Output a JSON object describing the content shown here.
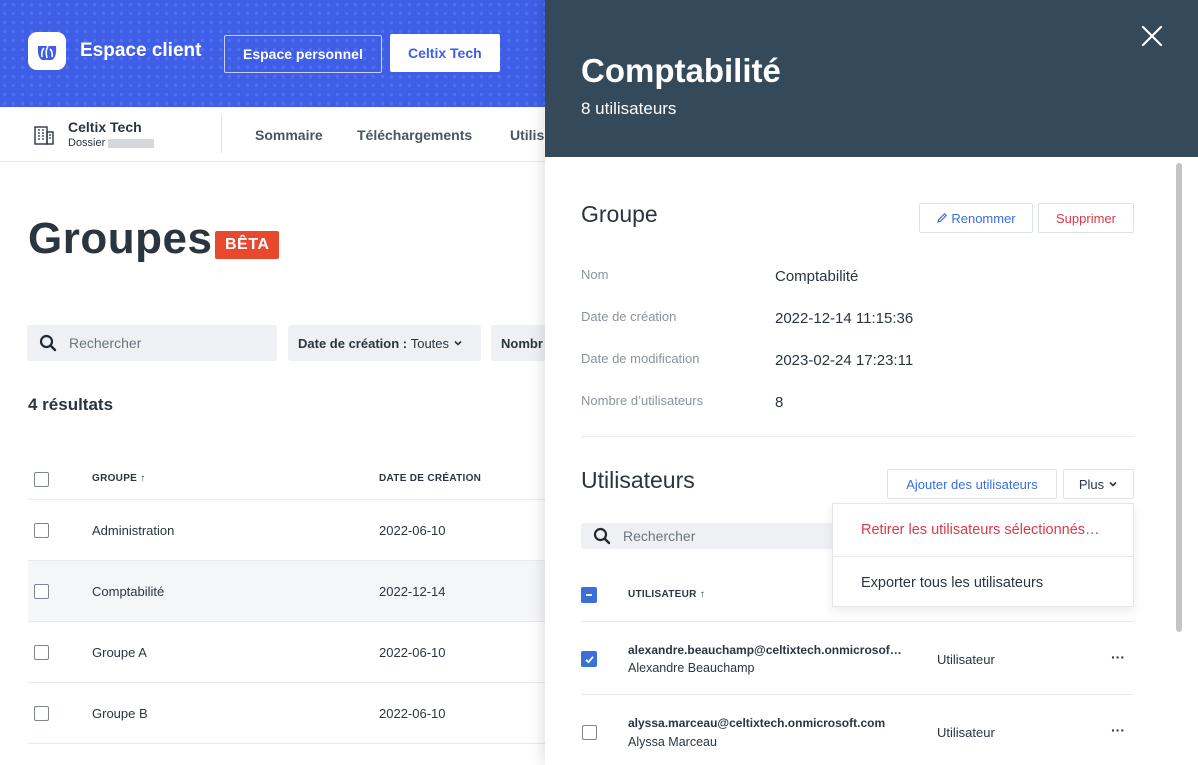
{
  "header": {
    "app_title": "Espace client",
    "btn_personal": "Espace personnel",
    "btn_org": "Celtix Tech",
    "colors": {
      "brand": "#3e5ee8",
      "accent_red": "#e8492d"
    }
  },
  "subnav": {
    "org_name": "Celtix Tech",
    "org_sub": "Dossier",
    "links": [
      "Sommaire",
      "Téléchargements",
      "Utilis"
    ]
  },
  "page": {
    "title": "Groupes",
    "badge": "BÊTA",
    "search_placeholder": "Rechercher",
    "filter_created_label": "Date de création :",
    "filter_created_value": "Toutes",
    "filter_count_label": "Nombr",
    "results": "4 résultats",
    "columns": {
      "group": "GROUPE",
      "created": "DATE DE CRÉATION"
    },
    "rows": [
      {
        "name": "Administration",
        "date": "2022-06-10"
      },
      {
        "name": "Comptabilité",
        "date": "2022-12-14"
      },
      {
        "name": "Groupe A",
        "date": "2022-06-10"
      },
      {
        "name": "Groupe B",
        "date": "2022-06-10"
      }
    ]
  },
  "drawer": {
    "title": "Comptabilité",
    "subtitle": "8 utilisateurs",
    "group_section": "Groupe",
    "btn_rename": "Renommer",
    "btn_delete": "Supprimer",
    "fields": [
      {
        "label": "Nom",
        "value": "Comptabilité"
      },
      {
        "label": "Date de création",
        "value": "2022-12-14 11:15:36"
      },
      {
        "label": "Date de modification",
        "value": "2023-02-24 17:23:11"
      },
      {
        "label": "Nombre d’utilisateurs",
        "value": "8"
      }
    ],
    "users_section": "Utilisateurs",
    "btn_add_users": "Ajouter des utilisateurs",
    "btn_more": "Plus",
    "search_placeholder": "Rechercher",
    "col_user": "UTILISATEUR",
    "menu": {
      "remove_selected": "Retirer les utilisateurs sélectionnés…",
      "export_all": "Exporter tous les utilisateurs"
    },
    "users": [
      {
        "email": "alexandre.beauchamp@celtixtech.onmicrosof…",
        "name": "Alexandre Beauchamp",
        "role": "Utilisateur",
        "more": "···",
        "checked": true
      },
      {
        "email": "alyssa.marceau@celtixtech.onmicrosoft.com",
        "name": "Alyssa Marceau",
        "role": "Utilisateur",
        "more": "···",
        "checked": false
      }
    ]
  }
}
